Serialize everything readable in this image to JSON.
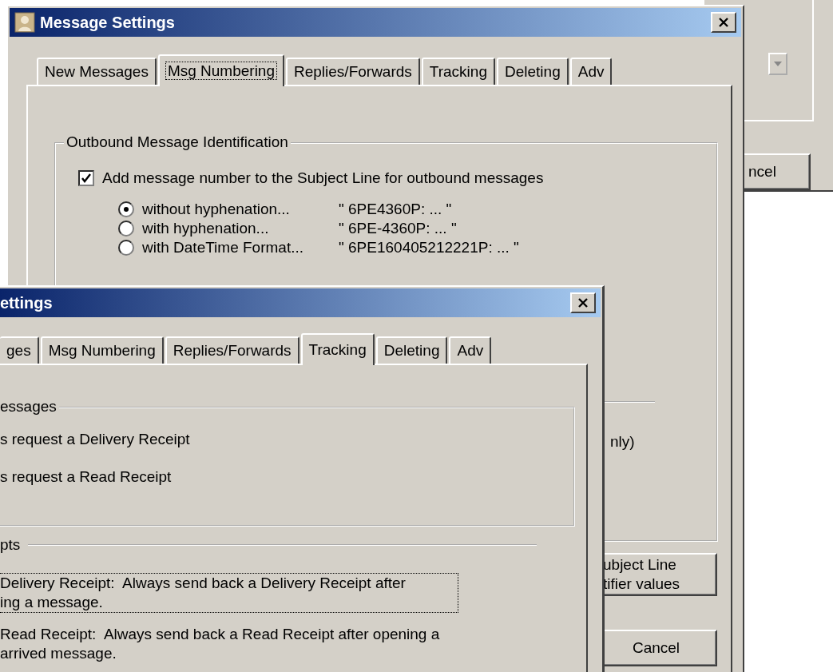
{
  "background_window": {
    "button": "ncel"
  },
  "main_window": {
    "title": "Message Settings",
    "tabs": [
      {
        "label": "New Messages",
        "selected": false
      },
      {
        "label": "Msg Numbering",
        "selected": true
      },
      {
        "label": "Replies/Forwards",
        "selected": false
      },
      {
        "label": "Tracking",
        "selected": false
      },
      {
        "label": "Deleting",
        "selected": false
      },
      {
        "label": "Adv",
        "selected": false
      }
    ],
    "group": {
      "title": "Outbound Message Identification",
      "checkbox": {
        "label": "Add message number to the Subject Line for outbound messages",
        "checked": true
      },
      "options": [
        {
          "label": "without hyphenation...",
          "example": "\" 6PE4360P: ... \"",
          "selected": true
        },
        {
          "label": "with hyphenation...",
          "example": "\" 6PE-4360P: ... \"",
          "selected": false
        },
        {
          "label": "with DateTime Format...",
          "example": "\" 6PE160405212221P: ... \"",
          "selected": false
        }
      ],
      "partial_text": "nly)"
    },
    "buttons": [
      {
        "lines": [
          "ubject Line",
          "tifier values"
        ]
      },
      {
        "lines": [
          "Cancel"
        ]
      }
    ]
  },
  "front_window": {
    "title": "ettings",
    "tabs": [
      {
        "label": "ges",
        "selected": false
      },
      {
        "label": "Msg Numbering",
        "selected": false
      },
      {
        "label": "Replies/Forwards",
        "selected": false
      },
      {
        "label": "Tracking",
        "selected": true
      },
      {
        "label": "Deleting",
        "selected": false
      },
      {
        "label": "Adv",
        "selected": false
      }
    ],
    "group_title": "essages",
    "items": [
      "s request a Delivery Receipt",
      "s request a Read Receipt"
    ],
    "section_title": "pts",
    "options": [
      {
        "lines": [
          "Delivery Receipt:  Always send back a Delivery Receipt after",
          "ing a message."
        ],
        "focused": true
      },
      {
        "lines": [
          "Read Receipt:  Always send back a Read Receipt after opening a",
          "arrived message."
        ],
        "focused": false
      }
    ]
  }
}
